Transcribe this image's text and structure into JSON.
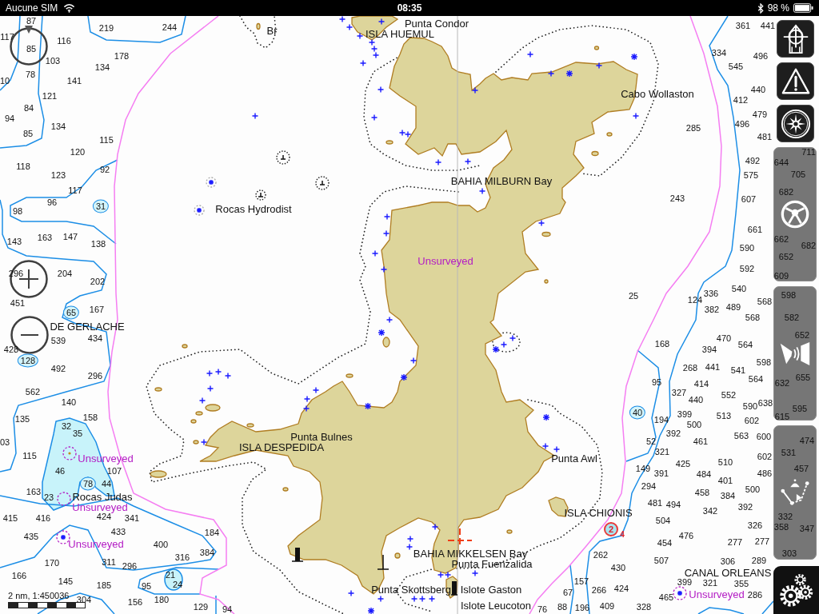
{
  "status_bar": {
    "carrier": "Aucune SIM",
    "time": "08:35",
    "battery": "98 %"
  },
  "chart": {
    "place_names": [
      {
        "text": "Punta Condor",
        "kind": "place"
      },
      {
        "text": "ISLA HUEMUL",
        "kind": "place"
      },
      {
        "text": "Br",
        "kind": "place"
      },
      {
        "text": "Cabo Wollaston",
        "kind": "place"
      },
      {
        "text": "BAHIA MILBURN Bay",
        "kind": "place"
      },
      {
        "text": "Rocas Hydrodist",
        "kind": "place"
      },
      {
        "text": "Unsurveyed",
        "kind": "unsurveyed"
      },
      {
        "text": "DE GERLACHE",
        "kind": "place"
      },
      {
        "text": "Punta Bulnes",
        "kind": "place"
      },
      {
        "text": "ISLA DESPEDIDA",
        "kind": "place"
      },
      {
        "text": "Unsurveyed",
        "kind": "unsurveyed"
      },
      {
        "text": "Punta Awl",
        "kind": "place"
      },
      {
        "text": "Rocas Judas",
        "kind": "place"
      },
      {
        "text": "Unsurveyed",
        "kind": "unsurveyed"
      },
      {
        "text": "ISLA CHIONIS",
        "kind": "place"
      },
      {
        "text": "Unsurveyed",
        "kind": "unsurveyed"
      },
      {
        "text": "BAHIA MIKKELSEN Bay",
        "kind": "place"
      },
      {
        "text": "Punta Fuenzalida",
        "kind": "place"
      },
      {
        "text": "CANAL ORLEANS",
        "kind": "place"
      },
      {
        "text": "Punta Skottsberg",
        "kind": "place"
      },
      {
        "text": "Islote Gaston",
        "kind": "place"
      },
      {
        "text": "Unsurveyed",
        "kind": "unsurveyed"
      },
      {
        "text": "Islote Leucoton",
        "kind": "place"
      }
    ],
    "soundings": [
      "87",
      "117",
      "85",
      "116",
      "219",
      "244",
      "103",
      "178",
      "134",
      "10",
      "78",
      "141",
      "121",
      "84",
      "94",
      "134",
      "85",
      "115",
      "120",
      "118",
      "123",
      "92",
      "117",
      "96",
      "98",
      "143",
      "163",
      "147",
      "138",
      "296",
      "204",
      "202",
      "451",
      "167",
      "539",
      "434",
      "428",
      "492",
      "296",
      "562",
      "140",
      "135",
      "158",
      "03",
      "32",
      "35",
      "115",
      "46",
      "107",
      "163",
      "23",
      "44",
      "415",
      "416",
      "424",
      "341",
      "435",
      "433",
      "400",
      "184",
      "316",
      "384",
      "170",
      "311",
      "296",
      "166",
      "145",
      "185",
      "95",
      "21",
      "24",
      "304",
      "156",
      "180",
      "129",
      "94",
      "361",
      "441",
      "334",
      "496",
      "545",
      "440",
      "412",
      "479",
      "285",
      "496",
      "481",
      "492",
      "575",
      "243",
      "607",
      "661",
      "590",
      "592",
      "25",
      "336",
      "540",
      "124",
      "382",
      "489",
      "568",
      "568",
      "168",
      "394",
      "470",
      "564",
      "268",
      "441",
      "541",
      "598",
      "95",
      "414",
      "564",
      "327",
      "440",
      "552",
      "590",
      "638",
      "194",
      "399",
      "500",
      "513",
      "602",
      "52",
      "392",
      "461",
      "563",
      "600",
      "321",
      "425",
      "510",
      "602",
      "149",
      "391",
      "484",
      "401",
      "486",
      "294",
      "458",
      "384",
      "500",
      "481",
      "494",
      "342",
      "392",
      "504",
      "326",
      "358",
      "454",
      "476",
      "277",
      "277",
      "262",
      "507",
      "306",
      "289",
      "430",
      "157",
      "399",
      "321",
      "355",
      "67",
      "266",
      "424",
      "465",
      "286",
      "76",
      "88",
      "196",
      "409",
      "328",
      "711",
      "644",
      "705",
      "682",
      "662",
      "682",
      "652",
      "609",
      "598",
      "582",
      "652",
      "632",
      "655",
      "595",
      "615",
      "474",
      "531",
      "457",
      "332",
      "347",
      "303"
    ],
    "circled_soundings": [
      "31",
      "65",
      "128",
      "78",
      "40"
    ],
    "marker": {
      "number": "2",
      "suffix": "4"
    },
    "scale": "2 nm, 1:450036"
  }
}
